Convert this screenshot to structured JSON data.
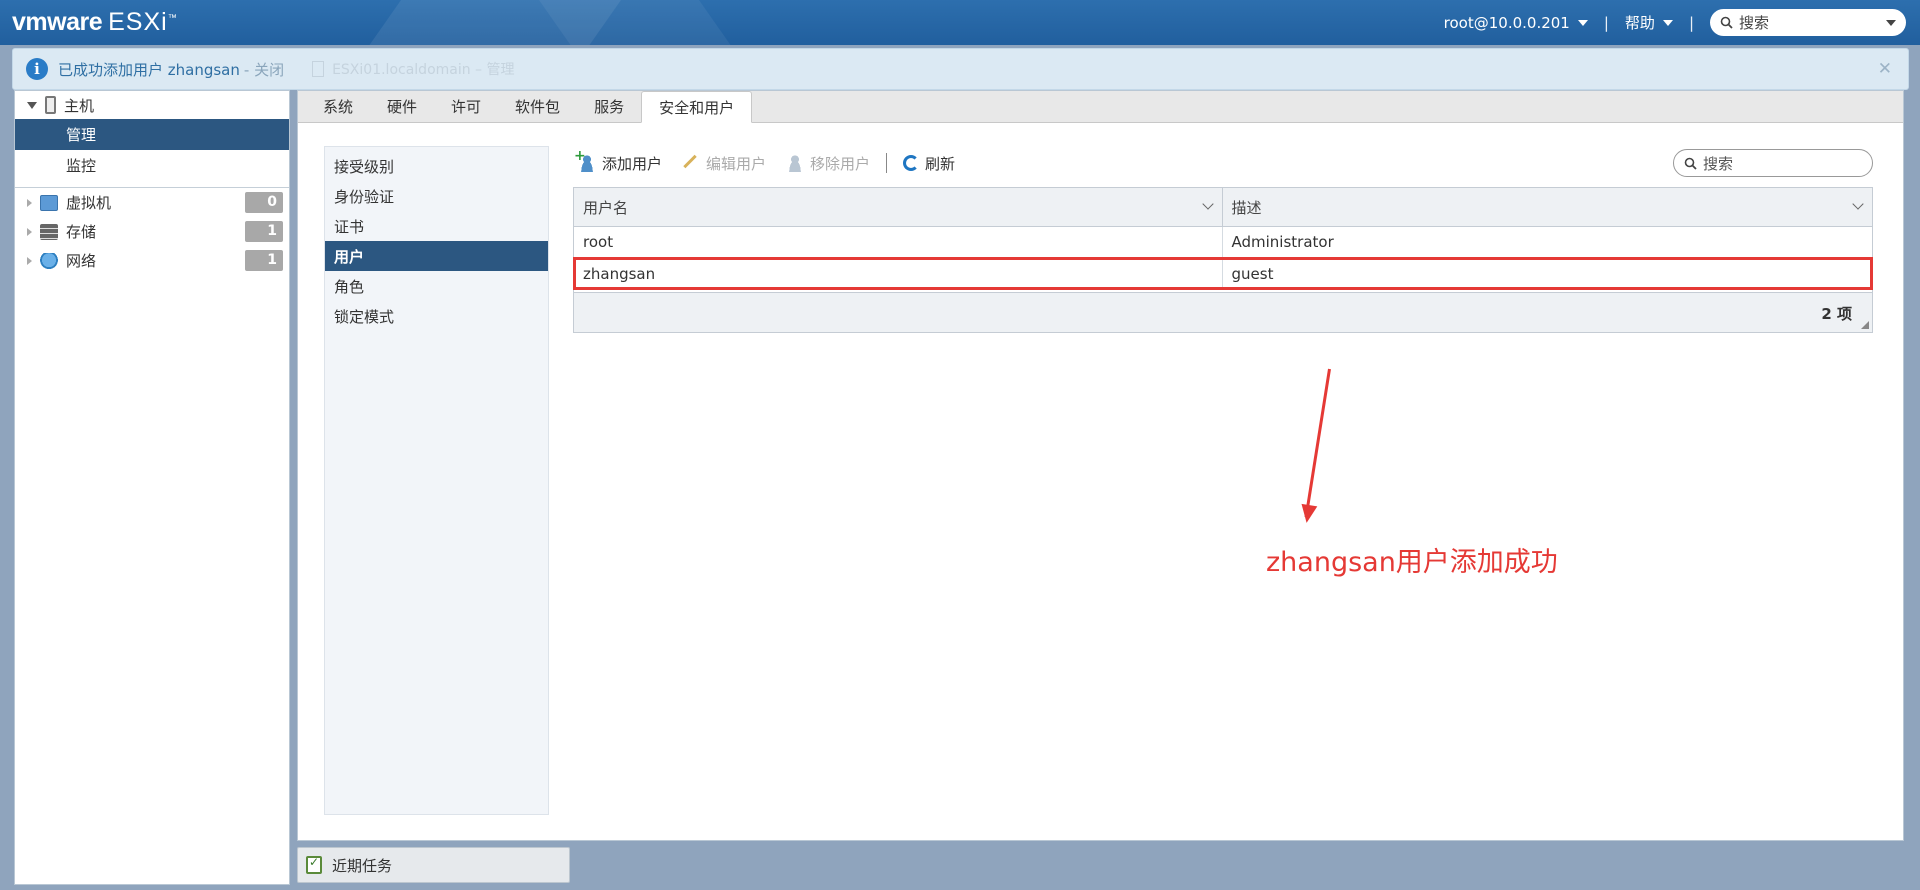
{
  "header": {
    "brand": "vmware",
    "product": "ESXi",
    "tm": "™",
    "user_menu": "root@10.0.0.201",
    "help_menu": "帮助",
    "separator": "|",
    "search_placeholder": "搜索"
  },
  "notification": {
    "message": "已成功添加用户 zhangsan",
    "close_link": " - 关闭",
    "background_text": "ESXi01.localdomain – 管理"
  },
  "sidebar": {
    "host": {
      "label": "主机"
    },
    "host_items": [
      {
        "label": "管理",
        "active": true
      },
      {
        "label": "监控",
        "active": false
      }
    ],
    "sections": [
      {
        "label": "虚拟机",
        "count": "0"
      },
      {
        "label": "存储",
        "count": "1"
      },
      {
        "label": "网络",
        "count": "1"
      }
    ]
  },
  "tabs": [
    {
      "label": "系统"
    },
    {
      "label": "硬件"
    },
    {
      "label": "许可"
    },
    {
      "label": "软件包"
    },
    {
      "label": "服务"
    },
    {
      "label": "安全和用户",
      "active": true
    }
  ],
  "subnav": [
    {
      "label": "接受级别"
    },
    {
      "label": "身份验证"
    },
    {
      "label": "证书"
    },
    {
      "label": "用户",
      "active": true
    },
    {
      "label": "角色"
    },
    {
      "label": "锁定模式"
    }
  ],
  "toolbar": {
    "add_user": "添加用户",
    "edit_user": "编辑用户",
    "remove_user": "移除用户",
    "refresh": "刷新",
    "search_placeholder": "搜索"
  },
  "table": {
    "columns": [
      "用户名",
      "描述"
    ],
    "rows": [
      [
        "root",
        "Administrator"
      ],
      [
        "zhangsan",
        "guest"
      ]
    ],
    "footer_count": "2 项"
  },
  "annotation": {
    "text": "zhangsan用户添加成功",
    "color": "#e53935"
  },
  "recent_tasks": {
    "label": "近期任务"
  },
  "colors": {
    "header_bg": "#215f9e",
    "selection_bg": "#2c5781",
    "info_blue": "#2a7cc7"
  }
}
